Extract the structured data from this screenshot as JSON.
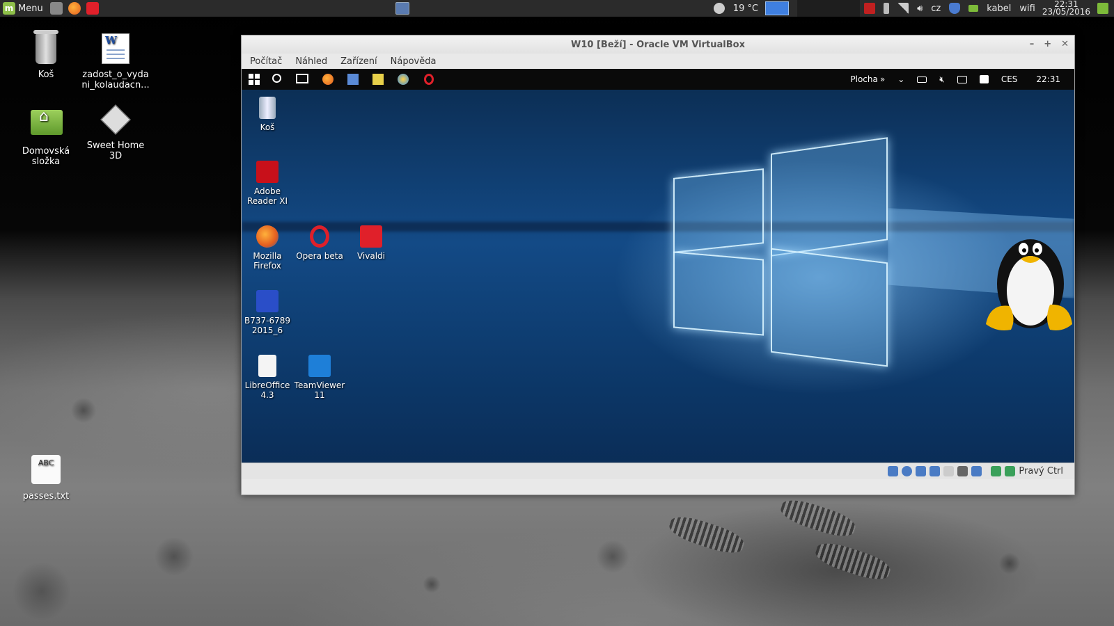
{
  "panel": {
    "menu_label": "Menu",
    "weather": "19 °C",
    "keyboard_layout": "cz",
    "network_wired": "kabel",
    "network_wifi": "wifi",
    "clock_time": "22:31",
    "clock_date": "23/05/2016"
  },
  "desktop_icons": {
    "trash": "Koš",
    "document": "zadost_o_vyda ni_kolaudacn...",
    "home": "Domovská složka",
    "sweethome": "Sweet Home 3D",
    "passes": "passes.txt",
    "passes_icon_text": "ABC"
  },
  "vbox": {
    "title": "W10 [Beží] - Oracle VM VirtualBox",
    "menu": [
      "Počítač",
      "Náhled",
      "Zařízení",
      "Nápověda"
    ],
    "host_key": "Pravý Ctrl"
  },
  "guest": {
    "taskbar": {
      "desktop_label": "Plocha",
      "language": "CES",
      "time": "22:31"
    },
    "icons": {
      "trash": "Koš",
      "adobe": "Adobe Reader XI",
      "firefox": "Mozilla Firefox",
      "opera": "Opera beta",
      "vivaldi": "Vivaldi",
      "b737": "B737-6789 2015_6",
      "libreoffice": "LibreOffice 4.3",
      "teamviewer": "TeamViewer 11"
    }
  },
  "colors": {
    "panel": "#2b2b2b",
    "guest_blue": "#134a86",
    "mint_green": "#8fc04a"
  }
}
